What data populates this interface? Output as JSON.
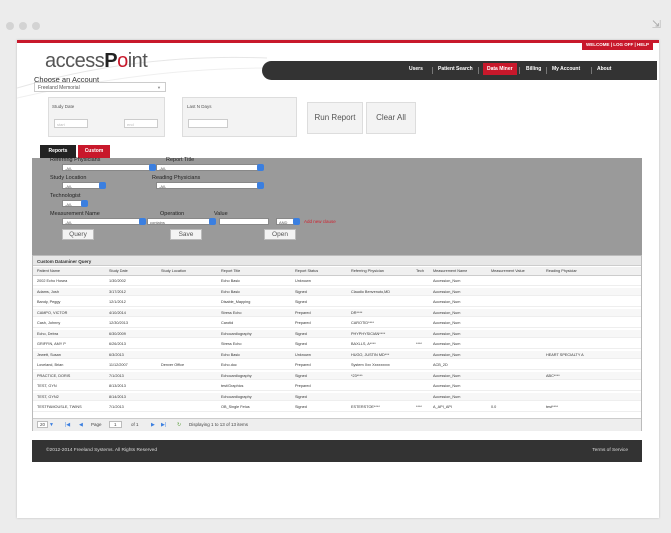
{
  "header": {
    "welcome": "WELCOME | LOG OFF | HELP",
    "logo_prefix": "access",
    "logo_p": "P",
    "logo_o": "o",
    "logo_suffix": "int"
  },
  "nav": [
    {
      "label": "Users",
      "active": false
    },
    {
      "label": "Patient Search",
      "active": false
    },
    {
      "label": "Data Miner",
      "active": true
    },
    {
      "label": "Billing",
      "active": false
    },
    {
      "label": "My Account",
      "active": false
    },
    {
      "label": "About",
      "active": false
    }
  ],
  "account": {
    "label": "Choose an Account",
    "selected": "Freeland Memorial"
  },
  "study_date": {
    "label": "Study Date",
    "start_placeholder": "start",
    "end_placeholder": "end"
  },
  "last_n_days": {
    "label": "Last N Days",
    "value": ""
  },
  "buttons": {
    "run_report": "Run Report",
    "clear_all": "Clear All"
  },
  "tabs": {
    "reports": "Reports",
    "custom": "Custom"
  },
  "filters": {
    "referring_physicians_label": "Referring Physicians",
    "referring_physicians_value": "-All-",
    "report_title_label": "Report Title",
    "report_title_value": "-All-",
    "study_location_label": "Study Location",
    "study_location_value": "-All-",
    "reading_physicians_label": "Reading Physicians",
    "reading_physicians_value": "-All-",
    "technologist_label": "Technologist",
    "technologist_value": "-All-",
    "measurement_name_label": "Measurement Name",
    "measurement_name_value": "-All-",
    "operation_label": "Operation",
    "operation_value": "contains",
    "value_label": "Value",
    "value_value": "",
    "logic_value": "AND",
    "add_condition": "Add new clause",
    "query_btn": "Query",
    "save_btn": "Save",
    "open_btn": "Open"
  },
  "grid": {
    "caption": "Custom Dataminer Query",
    "columns": [
      "Patient Name",
      "Study Date",
      "Study Location",
      "Report Title",
      "Report Status",
      "Referring Physician",
      "Tech",
      "Measurement Name",
      "Measurement Value",
      "Reading Physician"
    ],
    "rows": [
      [
        "2002 Echo Hosea",
        "1/30/2002",
        "",
        "Echo Basic",
        "Unknown",
        "",
        "",
        "Accession_Num",
        "",
        ""
      ],
      [
        "Adams, Josh",
        "3/17/2012",
        "",
        "Echo Basic",
        "Signed",
        "Claudio Benvenuto,MD",
        "",
        "Accession_Num",
        "",
        ""
      ],
      [
        "Bandy, Peggy",
        "12/1/2012",
        "",
        "Disable_Mapping",
        "Signed",
        "",
        "",
        "Accession_Num",
        "",
        ""
      ],
      [
        "CAMPO, VICTOR",
        "4/10/2014",
        "",
        "Stress Echo",
        "Prepared",
        "DR****",
        "",
        "Accession_Num",
        "",
        ""
      ],
      [
        "Cash, Johnny",
        "12/30/2013",
        "",
        "Carotid",
        "Prepared",
        "CAROTID****",
        "",
        "Accession_Num",
        "",
        ""
      ],
      [
        "Echo, Debra",
        "6/30/2009",
        "",
        "Echocardiography",
        "Signed",
        "PHYPHYSICIAN****",
        "",
        "Accession_Num",
        "",
        ""
      ],
      [
        "GRIFFIN, AMY P",
        "6/26/2013",
        "",
        "Stress Echo",
        "Signed",
        "BAXLLS, A****",
        "****",
        "Accession_Num",
        "",
        ""
      ],
      [
        "Jewett, Susan",
        "6/3/2013",
        "",
        "Echo Basic",
        "Unknown",
        "HUGO, JUSTIN MD***",
        "",
        "Accession_Num",
        "",
        "HEART SPECIALTY A"
      ],
      [
        "Loveland, Brian",
        "11/12/2007",
        "Denver Office",
        "Echo.doc",
        "Prepared",
        "System Xxx Xxxxxxxxx",
        "",
        "ACB_2D",
        "",
        ""
      ],
      [
        "PRACTICE, DORIS",
        "7/1/2013",
        "",
        "Echocardiography",
        "Signed",
        "*23****",
        "",
        "Accession_Num",
        "",
        "ABC****"
      ],
      [
        "TEST, GYN",
        "8/13/2013",
        "",
        "test/Graphics",
        "Prepared",
        "",
        "",
        "Accession_Num",
        "",
        ""
      ],
      [
        "TEST, GYN2",
        "8/14/2013",
        "",
        "Echocardiography",
        "Signed",
        "",
        "",
        "Accession_Num",
        "",
        ""
      ],
      [
        "TESTFAMOUSLE, TWINS",
        "7/1/2013",
        "",
        "OB_Single Fetus",
        "Signed",
        "ESTERSTOE****",
        "****",
        "A_API_API",
        "0.0",
        "test****"
      ]
    ],
    "pager": {
      "page_size": "20",
      "page_label": "Page",
      "page_value": "1",
      "of_label": "of 1",
      "display_text": "Displaying 1 to 13 of 13 items"
    }
  },
  "footer": {
    "copyright": "©2012-2014 Freeland Systems. All Rights Reserved",
    "terms": "Terms of Service"
  },
  "colors": {
    "brand_red": "#c8182b",
    "nav_dark": "#333333",
    "panel_gray": "#9a9a9a",
    "knob_blue": "#3b7fe0"
  }
}
